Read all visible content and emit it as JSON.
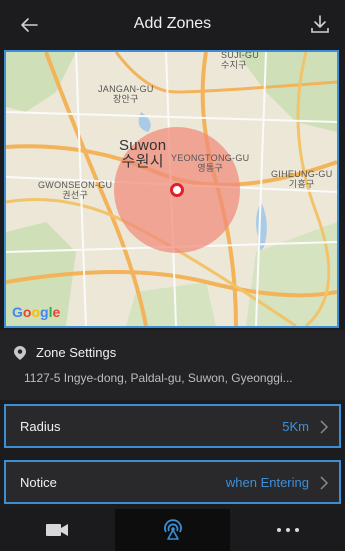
{
  "header": {
    "title": "Add Zones",
    "back_icon": "arrow-left-icon",
    "download_icon": "download-icon"
  },
  "map": {
    "labels": {
      "suwon_en": "Suwon",
      "suwon_ko": "수원시",
      "jangan_en": "JANGAN-GU",
      "jangan_ko": "장안구",
      "yeongtong_en": "YEONGTONG-GU",
      "yeongtong_ko": "영통구",
      "gwonseon_en": "GWONSEON-GU",
      "gwonseon_ko": "권선구",
      "giheung_en": "GIHEUNG-GU",
      "giheung_ko": "기흥구",
      "sujigu_en": "SUJI-GU",
      "sujigu_ko": "수지구"
    },
    "logo": "Google",
    "zone_color": "#f08b7a",
    "marker_color": "#e0202a"
  },
  "zone_settings": {
    "icon": "location-pin-icon",
    "label": "Zone Settings",
    "address": "1127-5 Ingye-dong, Paldal-gu, Suwon, Gyeonggi..."
  },
  "radius": {
    "label": "Radius",
    "value": "5Km"
  },
  "notice": {
    "label": "Notice",
    "value": "when Entering"
  },
  "bottom_nav": {
    "items": [
      {
        "icon": "video-camera-icon",
        "active": false
      },
      {
        "icon": "geofence-signal-icon",
        "active": true
      },
      {
        "icon": "more-dots-icon",
        "active": false
      }
    ]
  },
  "colors": {
    "accent": "#3a8fd6",
    "background": "#1c1c1e",
    "value_text": "#3f8fd8"
  }
}
